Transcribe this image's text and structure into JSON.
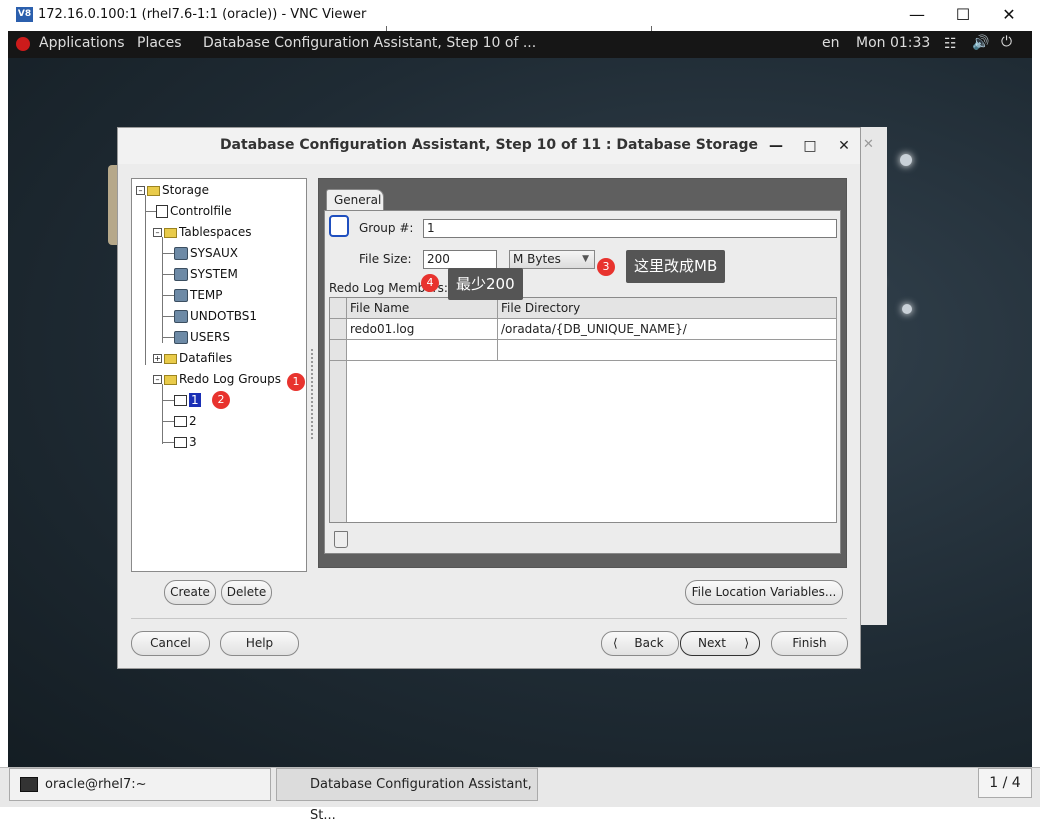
{
  "vnc": {
    "title": "172.16.0.100:1 (rhel7.6-1:1 (oracle)) - VNC Viewer",
    "logo": "V8"
  },
  "gnome_bar": {
    "applications": "Applications",
    "places": "Places",
    "active_window": "Database Configuration Assistant, Step 10 of ...",
    "lang": "en",
    "clock": "Mon 01:33"
  },
  "dialog": {
    "title": "Database Configuration Assistant, Step 10 of 11 : Database Storage"
  },
  "tree": {
    "root": "Storage",
    "controlfile": "Controlfile",
    "tablespaces": "Tablespaces",
    "tablespace_items": [
      "SYSAUX",
      "SYSTEM",
      "TEMP",
      "UNDOTBS1",
      "USERS"
    ],
    "datafiles": "Datafiles",
    "redo_groups": "Redo Log Groups",
    "redo_items": [
      "1",
      "2",
      "3"
    ]
  },
  "tabs": {
    "general": "General"
  },
  "form": {
    "group_label": "Group #:",
    "group_value": "1",
    "size_label": "File Size:",
    "size_value": "200",
    "unit_value": "M Bytes",
    "members_label": "Redo Log Members:"
  },
  "table": {
    "columns": [
      "File Name",
      "File Directory"
    ],
    "rows": [
      [
        "redo01.log",
        "/oradata/{DB_UNIQUE_NAME}/"
      ],
      [
        "",
        ""
      ]
    ]
  },
  "annotations": {
    "badge1": "1",
    "badge2": "2",
    "badge3": "3",
    "badge4": "4",
    "callout3": "这里改成MB",
    "callout4": "最少200"
  },
  "buttons": {
    "create": "Create",
    "delete": "Delete",
    "file_location": "File Location Variables...",
    "cancel": "Cancel",
    "help": "Help",
    "back": "Back",
    "next": "Next",
    "finish": "Finish"
  },
  "taskbar": {
    "terminal": "oracle@rhel7:~",
    "dbca": "Database Configuration Assistant, St...",
    "pager": "1 / 4"
  }
}
